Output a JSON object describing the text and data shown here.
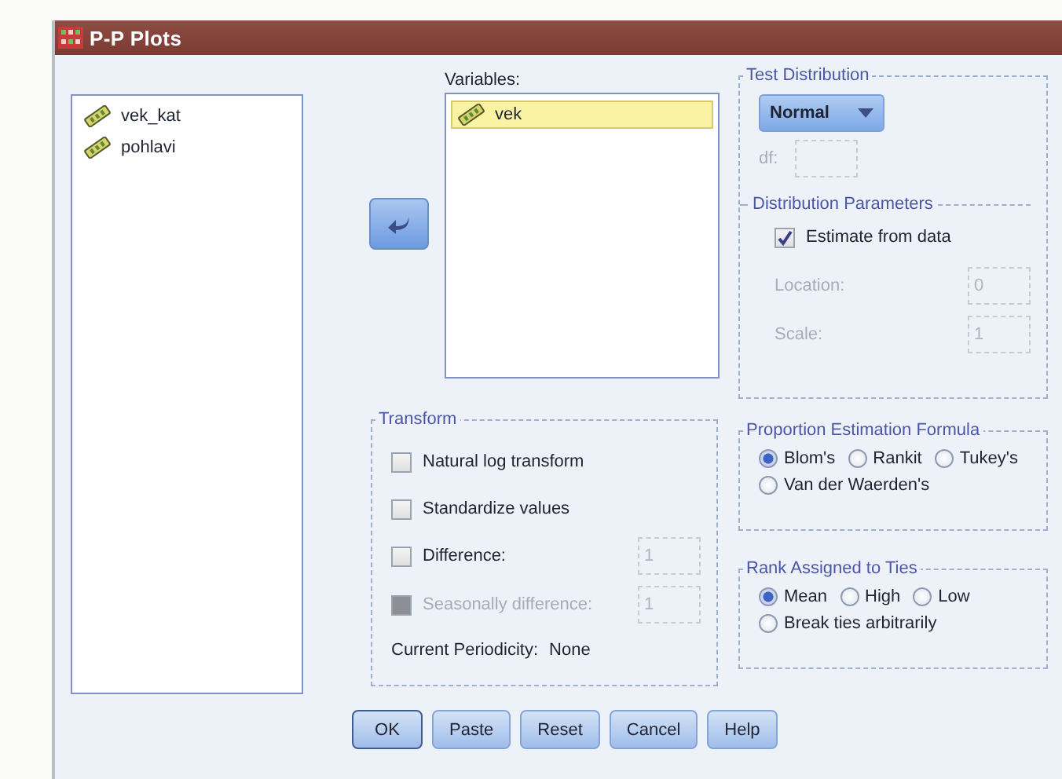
{
  "window": {
    "title": "P-P Plots"
  },
  "source_list": {
    "items": [
      {
        "label": "vek_kat"
      },
      {
        "label": "pohlavi"
      }
    ]
  },
  "variables": {
    "label": "Variables:",
    "items": [
      {
        "label": "vek",
        "selected": true
      }
    ]
  },
  "test_distribution": {
    "title": "Test Distribution",
    "distribution": "Normal",
    "df_label": "df:",
    "parameters": {
      "title": "Distribution Parameters",
      "estimate": {
        "label": "Estimate from data",
        "checked": true
      },
      "fields": [
        {
          "label": "Location:",
          "value": "0",
          "disabled": true
        },
        {
          "label": "Scale:",
          "value": "1",
          "disabled": true
        }
      ]
    }
  },
  "transform": {
    "title": "Transform",
    "options": [
      {
        "label": "Natural log transform",
        "checked": false,
        "disabled": false
      },
      {
        "label": "Standardize values",
        "checked": false,
        "disabled": false
      },
      {
        "label": "Difference:",
        "checked": false,
        "disabled": false,
        "value": "1"
      },
      {
        "label": "Seasonally difference:",
        "checked": false,
        "disabled": true,
        "value": "1"
      }
    ],
    "periodicity_label": "Current Periodicity:",
    "periodicity": "None"
  },
  "proportion_formula": {
    "title": "Proportion Estimation Formula",
    "options": [
      {
        "label": "Blom's",
        "selected": true
      },
      {
        "label": "Rankit",
        "selected": false
      },
      {
        "label": "Tukey's",
        "selected": false
      },
      {
        "label": "Van der Waerden's",
        "selected": false
      }
    ]
  },
  "rank_ties": {
    "title": "Rank Assigned to Ties",
    "options": [
      {
        "label": "Mean",
        "selected": true
      },
      {
        "label": "High",
        "selected": false
      },
      {
        "label": "Low",
        "selected": false
      },
      {
        "label": "Break ties arbitrarily",
        "selected": false
      }
    ]
  },
  "buttons": [
    {
      "label": "OK",
      "default": true
    },
    {
      "label": "Paste",
      "default": false
    },
    {
      "label": "Reset",
      "default": false
    },
    {
      "label": "Cancel",
      "default": false
    },
    {
      "label": "Help",
      "default": false
    }
  ]
}
